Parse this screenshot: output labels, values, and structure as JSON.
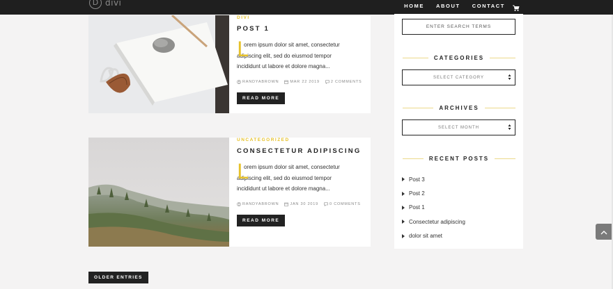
{
  "header": {
    "logo_letter": "D",
    "logo_text": "divi",
    "nav": [
      "HOME",
      "ABOUT",
      "CONTACT"
    ],
    "cart_icon": "shopping-cart-icon"
  },
  "posts": [
    {
      "category": "DIVI",
      "title": "POST 1",
      "dropcap": "L",
      "excerpt": "orem ipsum dolor sit amet, consectetur adipiscing elit, sed do eiusmod tempor incididunt ut labore et dolore magna...",
      "author": "RANDYABROWN",
      "date": "MAR 22 2019",
      "comments": "2 COMMENTS",
      "read_more": "READ MORE"
    },
    {
      "category": "UNCATEGORIZED",
      "title": "CONSECTETUR ADIPISCING",
      "dropcap": "L",
      "excerpt": "orem ipsum dolor sit amet, consectetur adipiscing elit, sed do eiusmod tempor incididunt ut labore et dolore magna...",
      "author": "RANDYABROWN",
      "date": "JAN 30 2019",
      "comments": "0 COMMENTS",
      "read_more": "READ MORE"
    }
  ],
  "older_entries": "OLDER ENTRIES",
  "sidebar": {
    "search_placeholder": "ENTER SEARCH TERMS",
    "categories_title": "CATEGORIES",
    "categories_select": "SELECT CATEGORY",
    "archives_title": "ARCHIVES",
    "archives_select": "SELECT MONTH",
    "recent_title": "RECENT POSTS",
    "recent_posts": [
      "Post 3",
      "Post 2",
      "Post 1",
      "Consectetur adipiscing",
      "dolor sit amet"
    ]
  },
  "colors": {
    "accent": "#e6c12a",
    "topbar": "#1f1f1f",
    "button": "#222222"
  }
}
